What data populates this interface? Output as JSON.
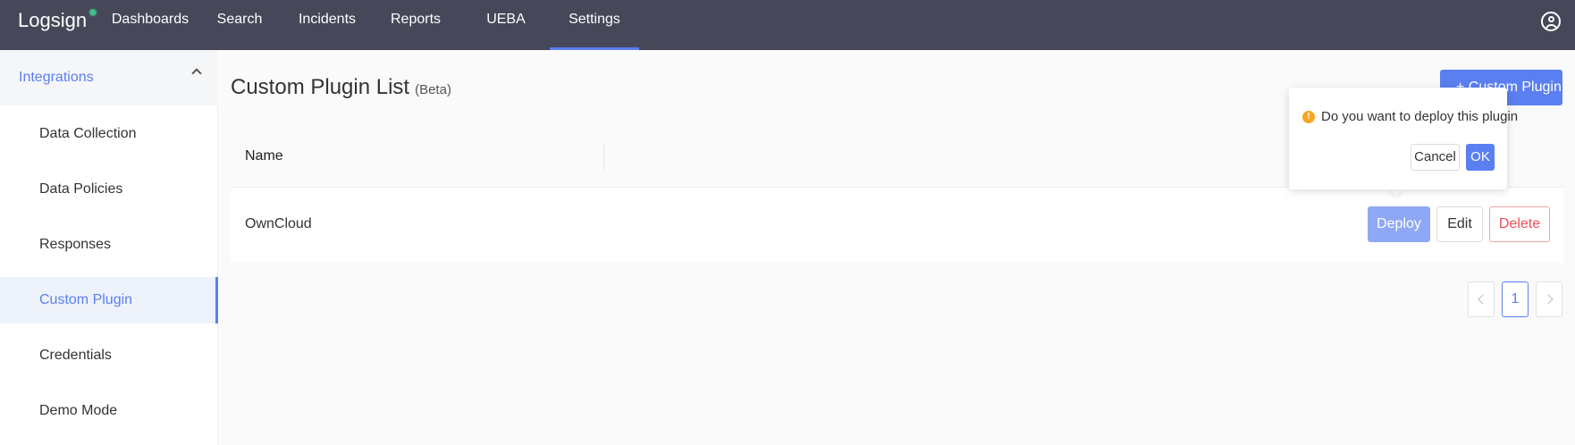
{
  "nav": {
    "logo": "Logsign",
    "items": [
      {
        "label": "Dashboards"
      },
      {
        "label": "Search"
      },
      {
        "label": "Incidents"
      },
      {
        "label": "Reports"
      },
      {
        "label": "UEBA"
      },
      {
        "label": "Settings",
        "active": true
      }
    ],
    "user_icon": "user-circle-icon"
  },
  "sidebar": {
    "group_label": "Integrations",
    "items": [
      {
        "label": "Data Collection"
      },
      {
        "label": "Data Policies"
      },
      {
        "label": "Responses"
      },
      {
        "label": "Custom Plugin",
        "active": true
      },
      {
        "label": "Credentials"
      },
      {
        "label": "Demo Mode"
      }
    ]
  },
  "main": {
    "title": "Custom Plugin List",
    "title_badge": "(Beta)",
    "add_button": "+ Custom Plugin",
    "table": {
      "columns": [
        "Name"
      ],
      "rows": [
        {
          "name": "OwnCloud",
          "actions": [
            "Deploy",
            "Edit",
            "Delete"
          ]
        }
      ]
    },
    "popconfirm": {
      "message": "Do you want to deploy this plugin",
      "cancel": "Cancel",
      "ok": "OK"
    },
    "pagination": {
      "current": "1"
    }
  },
  "colors": {
    "topbar": "#464758",
    "accent": "#5a7ff0",
    "danger": "#f04c5a",
    "warning": "#f5a623"
  }
}
